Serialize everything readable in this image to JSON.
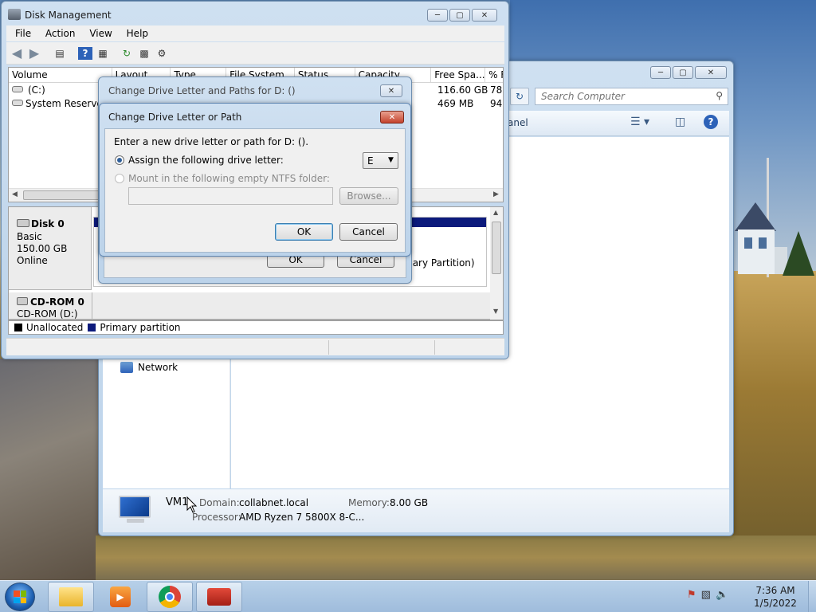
{
  "disk_mgmt": {
    "title": "Disk Management",
    "menu": [
      "File",
      "Action",
      "View",
      "Help"
    ],
    "columns": [
      "Volume",
      "Layout",
      "Type",
      "File System",
      "Status",
      "Capacity",
      "Free Spa...",
      "% F"
    ],
    "volumes": [
      {
        "name": "(C:)",
        "free": "116.60 GB",
        "pct": "78"
      },
      {
        "name": "System Reserved",
        "free": "469 MB",
        "pct": "94"
      }
    ],
    "disk0": {
      "name": "Disk 0",
      "type": "Basic",
      "size": "150.00 GB",
      "status": "Online"
    },
    "cdrom0": {
      "name": "CD-ROM 0",
      "drive": "CD-ROM (D:)"
    },
    "partition_partial": "mary Partition)",
    "legend": {
      "unallocated": "Unallocated",
      "primary": "Primary partition"
    }
  },
  "computer_win": {
    "search_placeholder": "Search Computer",
    "panel_partial": "anel",
    "network": "Network",
    "details": {
      "name": "VM1",
      "domain_label": "Domain:",
      "domain_value": "collabnet.local",
      "memory_label": "Memory:",
      "memory_value": "8.00 GB",
      "processor_label": "Processor:",
      "processor_value": "AMD Ryzen 7 5800X 8-C..."
    }
  },
  "paths_dialog": {
    "title": "Change Drive Letter and Paths for D: ()",
    "ok": "OK",
    "cancel": "Cancel"
  },
  "letter_dialog": {
    "title": "Change Drive Letter or Path",
    "prompt": "Enter a new drive letter or path for D: ().",
    "assign_label": "Assign the following drive letter:",
    "drive_letter": "E",
    "mount_label": "Mount in the following empty NTFS folder:",
    "browse": "Browse...",
    "ok": "OK",
    "cancel": "Cancel"
  },
  "taskbar": {
    "time": "7:36 AM",
    "date": "1/5/2022",
    "apps": [
      "file-explorer",
      "media-player",
      "chrome",
      "toolbox"
    ]
  }
}
